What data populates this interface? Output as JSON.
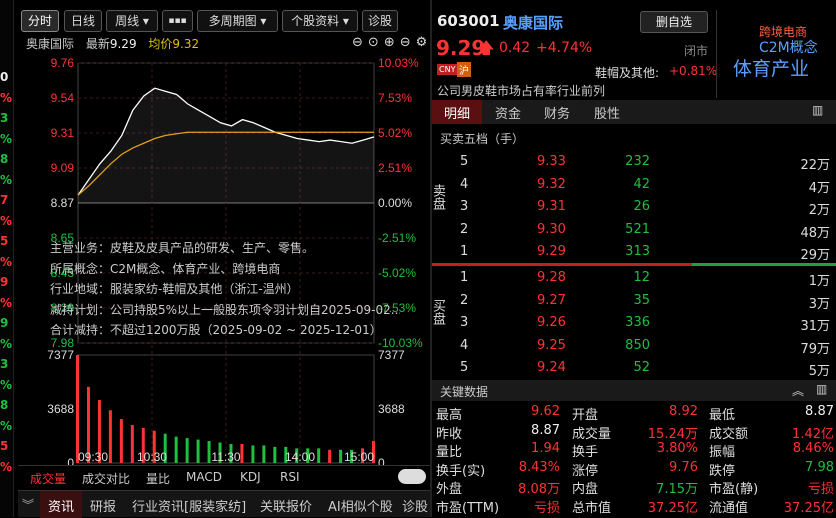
{
  "toolbar": {
    "tabs": [
      "分时",
      "日线",
      "周线 ▾",
      "▪▪▪",
      "多周期图 ▾",
      "个股资料 ▾",
      "诊股"
    ]
  },
  "chart_header": {
    "name": "奥康国际",
    "latest_label": "最新",
    "latest": "9.29",
    "avg_label": "均价",
    "avg": "9.32"
  },
  "chart_data": {
    "type": "line",
    "y_ticks_left": [
      "9.76",
      "9.54",
      "9.31",
      "9.09",
      "8.87",
      "8.65",
      "8.43",
      "8.20",
      "7.98"
    ],
    "y_ticks_right": [
      "10.03%",
      "7.53%",
      "5.02%",
      "2.51%",
      "0.00%",
      "-2.51%",
      "-5.02%",
      "-7.53%",
      "-10.03%"
    ],
    "x_ticks": [
      "09:30",
      "10:30",
      "11:30",
      "14:00",
      "15:00"
    ],
    "vol_ticks": [
      "7377",
      "3688",
      "0"
    ],
    "ylim": [
      7.98,
      9.76
    ],
    "prev_close": 8.87,
    "price": [
      8.92,
      9.02,
      9.12,
      9.2,
      9.3,
      9.46,
      9.55,
      9.6,
      9.58,
      9.56,
      9.5,
      9.46,
      9.42,
      9.38,
      9.36,
      9.4,
      9.38,
      9.35,
      9.32,
      9.3,
      9.28,
      9.27,
      9.26,
      9.27,
      9.26,
      9.25,
      9.27,
      9.29
    ],
    "avg": [
      8.92,
      8.98,
      9.05,
      9.12,
      9.18,
      9.22,
      9.25,
      9.28,
      9.3,
      9.31,
      9.32,
      9.32,
      9.32,
      9.32,
      9.32,
      9.32,
      9.32,
      9.32,
      9.32,
      9.32,
      9.32,
      9.32,
      9.32,
      9.32,
      9.32,
      9.32,
      9.32,
      9.32
    ],
    "volume": [
      7377,
      5200,
      4300,
      3600,
      3000,
      2600,
      2400,
      2200,
      2000,
      1800,
      1700,
      1600,
      1500,
      1400,
      1300,
      1300,
      1200,
      1200,
      1100,
      1100,
      1000,
      1000,
      1000,
      900,
      900,
      900,
      1000,
      1500
    ]
  },
  "overlay": {
    "l1": "主营业务：皮鞋及皮具产品的研发、生产、零售。",
    "l2": "所属概念：C2M概念、体育产业、跨境电商",
    "l3": "行业地域：服装家纺-鞋帽及其他（浙江-温州）",
    "l4": "减持计划：公司持股5%以上一般股东项令羽计划自2025-09-02...",
    "l5": "合计减持：不超过1200万股（2025-09-02 ~ 2025-12-01）"
  },
  "indicator_tabs": [
    "成交量",
    "成交对比",
    "量比",
    "MACD",
    "KDJ",
    "RSI"
  ],
  "bottom_tabs": [
    "资讯",
    "研报",
    "行业资讯[服装家纺]",
    "关联报价",
    "AI相似个股",
    "诊股"
  ],
  "stock": {
    "code": "603001",
    "name": "奥康国际",
    "price": "9.29",
    "change": "0.42",
    "pct": "+4.74%",
    "fav_btn": "删自选",
    "status": "闭市",
    "tag1": "CNY",
    "tag2": "沪",
    "sector_label": "鞋帽及其他:",
    "sector_pct": "+0.81%",
    "note": "公司男皮鞋市场占有率行业前列",
    "concepts": [
      "跨境电商",
      "C2M概念",
      "体育产业"
    ]
  },
  "right_tabs": [
    "明细",
    "资金",
    "财务",
    "股性"
  ],
  "orderbook_title": "买卖五档（手）",
  "asks": [
    {
      "lvl": "5",
      "price": "9.33",
      "vol": "232",
      "amt": "22万"
    },
    {
      "lvl": "4",
      "price": "9.32",
      "vol": "42",
      "amt": "4万"
    },
    {
      "lvl": "3",
      "price": "9.31",
      "vol": "26",
      "amt": "2万"
    },
    {
      "lvl": "2",
      "price": "9.30",
      "vol": "521",
      "amt": "48万"
    },
    {
      "lvl": "1",
      "price": "9.29",
      "vol": "313",
      "amt": "29万"
    }
  ],
  "bids": [
    {
      "lvl": "1",
      "price": "9.28",
      "vol": "12",
      "amt": "1万"
    },
    {
      "lvl": "2",
      "price": "9.27",
      "vol": "35",
      "amt": "3万"
    },
    {
      "lvl": "3",
      "price": "9.26",
      "vol": "336",
      "amt": "31万"
    },
    {
      "lvl": "4",
      "price": "9.25",
      "vol": "850",
      "amt": "79万"
    },
    {
      "lvl": "5",
      "price": "9.24",
      "vol": "52",
      "amt": "5万"
    }
  ],
  "sell_label": "卖盘",
  "buy_label": "买盘",
  "key_title": "关键数据",
  "key_data": [
    [
      [
        "最高",
        "9.62",
        "red"
      ],
      [
        "开盘",
        "8.92",
        "red"
      ],
      [
        "最低",
        "8.87",
        "white"
      ]
    ],
    [
      [
        "昨收",
        "8.87",
        "white"
      ],
      [
        "成交量",
        "15.24万",
        "red"
      ],
      [
        "成交额",
        "1.42亿",
        "red"
      ]
    ],
    [
      [
        "量比",
        "1.94",
        "red"
      ],
      [
        "换手",
        "3.80%",
        "red"
      ],
      [
        "振幅",
        "8.46%",
        "red"
      ]
    ],
    [
      [
        "换手(实)",
        "8.43%",
        "red"
      ],
      [
        "涨停",
        "9.76",
        "red"
      ],
      [
        "跌停",
        "7.98",
        "green"
      ]
    ],
    [
      [
        "外盘",
        "8.08万",
        "red"
      ],
      [
        "内盘",
        "7.15万",
        "green"
      ],
      [
        "市盈(静)",
        "亏损",
        "red"
      ]
    ],
    [
      [
        "市盈(TTM)",
        "亏损",
        "red"
      ],
      [
        "总市值",
        "37.25亿",
        "red"
      ],
      [
        "流通值",
        "37.25亿",
        "red"
      ]
    ]
  ],
  "sidebar": [
    "0",
    "%",
    "3",
    "%",
    "8",
    "%",
    "7",
    "%",
    "5",
    "%",
    "9",
    "%",
    "9",
    "%",
    "3",
    "%",
    "8",
    "%",
    "5",
    "%"
  ]
}
